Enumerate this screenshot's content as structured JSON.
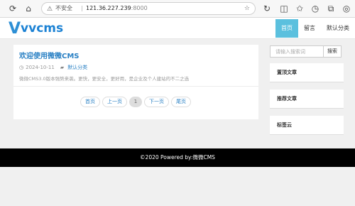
{
  "browser": {
    "insecure_label": "不安全",
    "url_host": "121.36.227.239",
    "url_port": ":8000"
  },
  "site": {
    "logo_text": "vvcms",
    "nav": [
      {
        "label": "首页",
        "active": true
      },
      {
        "label": "留言",
        "active": false
      },
      {
        "label": "默认分类",
        "active": false
      }
    ]
  },
  "post": {
    "title": "欢迎使用微微CMS",
    "date": "2024-10-11",
    "category": "默认分类",
    "excerpt": "微微CMS3.0版本强势来袭。更快，更安全，更好用，是企业及个人建站的不二之选"
  },
  "pagination": {
    "first": "首页",
    "prev": "上一页",
    "current": "1",
    "next": "下一页",
    "last": "尾页"
  },
  "sidebar": {
    "search_placeholder": "请输入搜索词",
    "search_button": "搜索",
    "sections": [
      "置顶文章",
      "推荐文章",
      "标签云"
    ]
  },
  "footer": {
    "text": "©2020   Powered by:微微CMS"
  }
}
